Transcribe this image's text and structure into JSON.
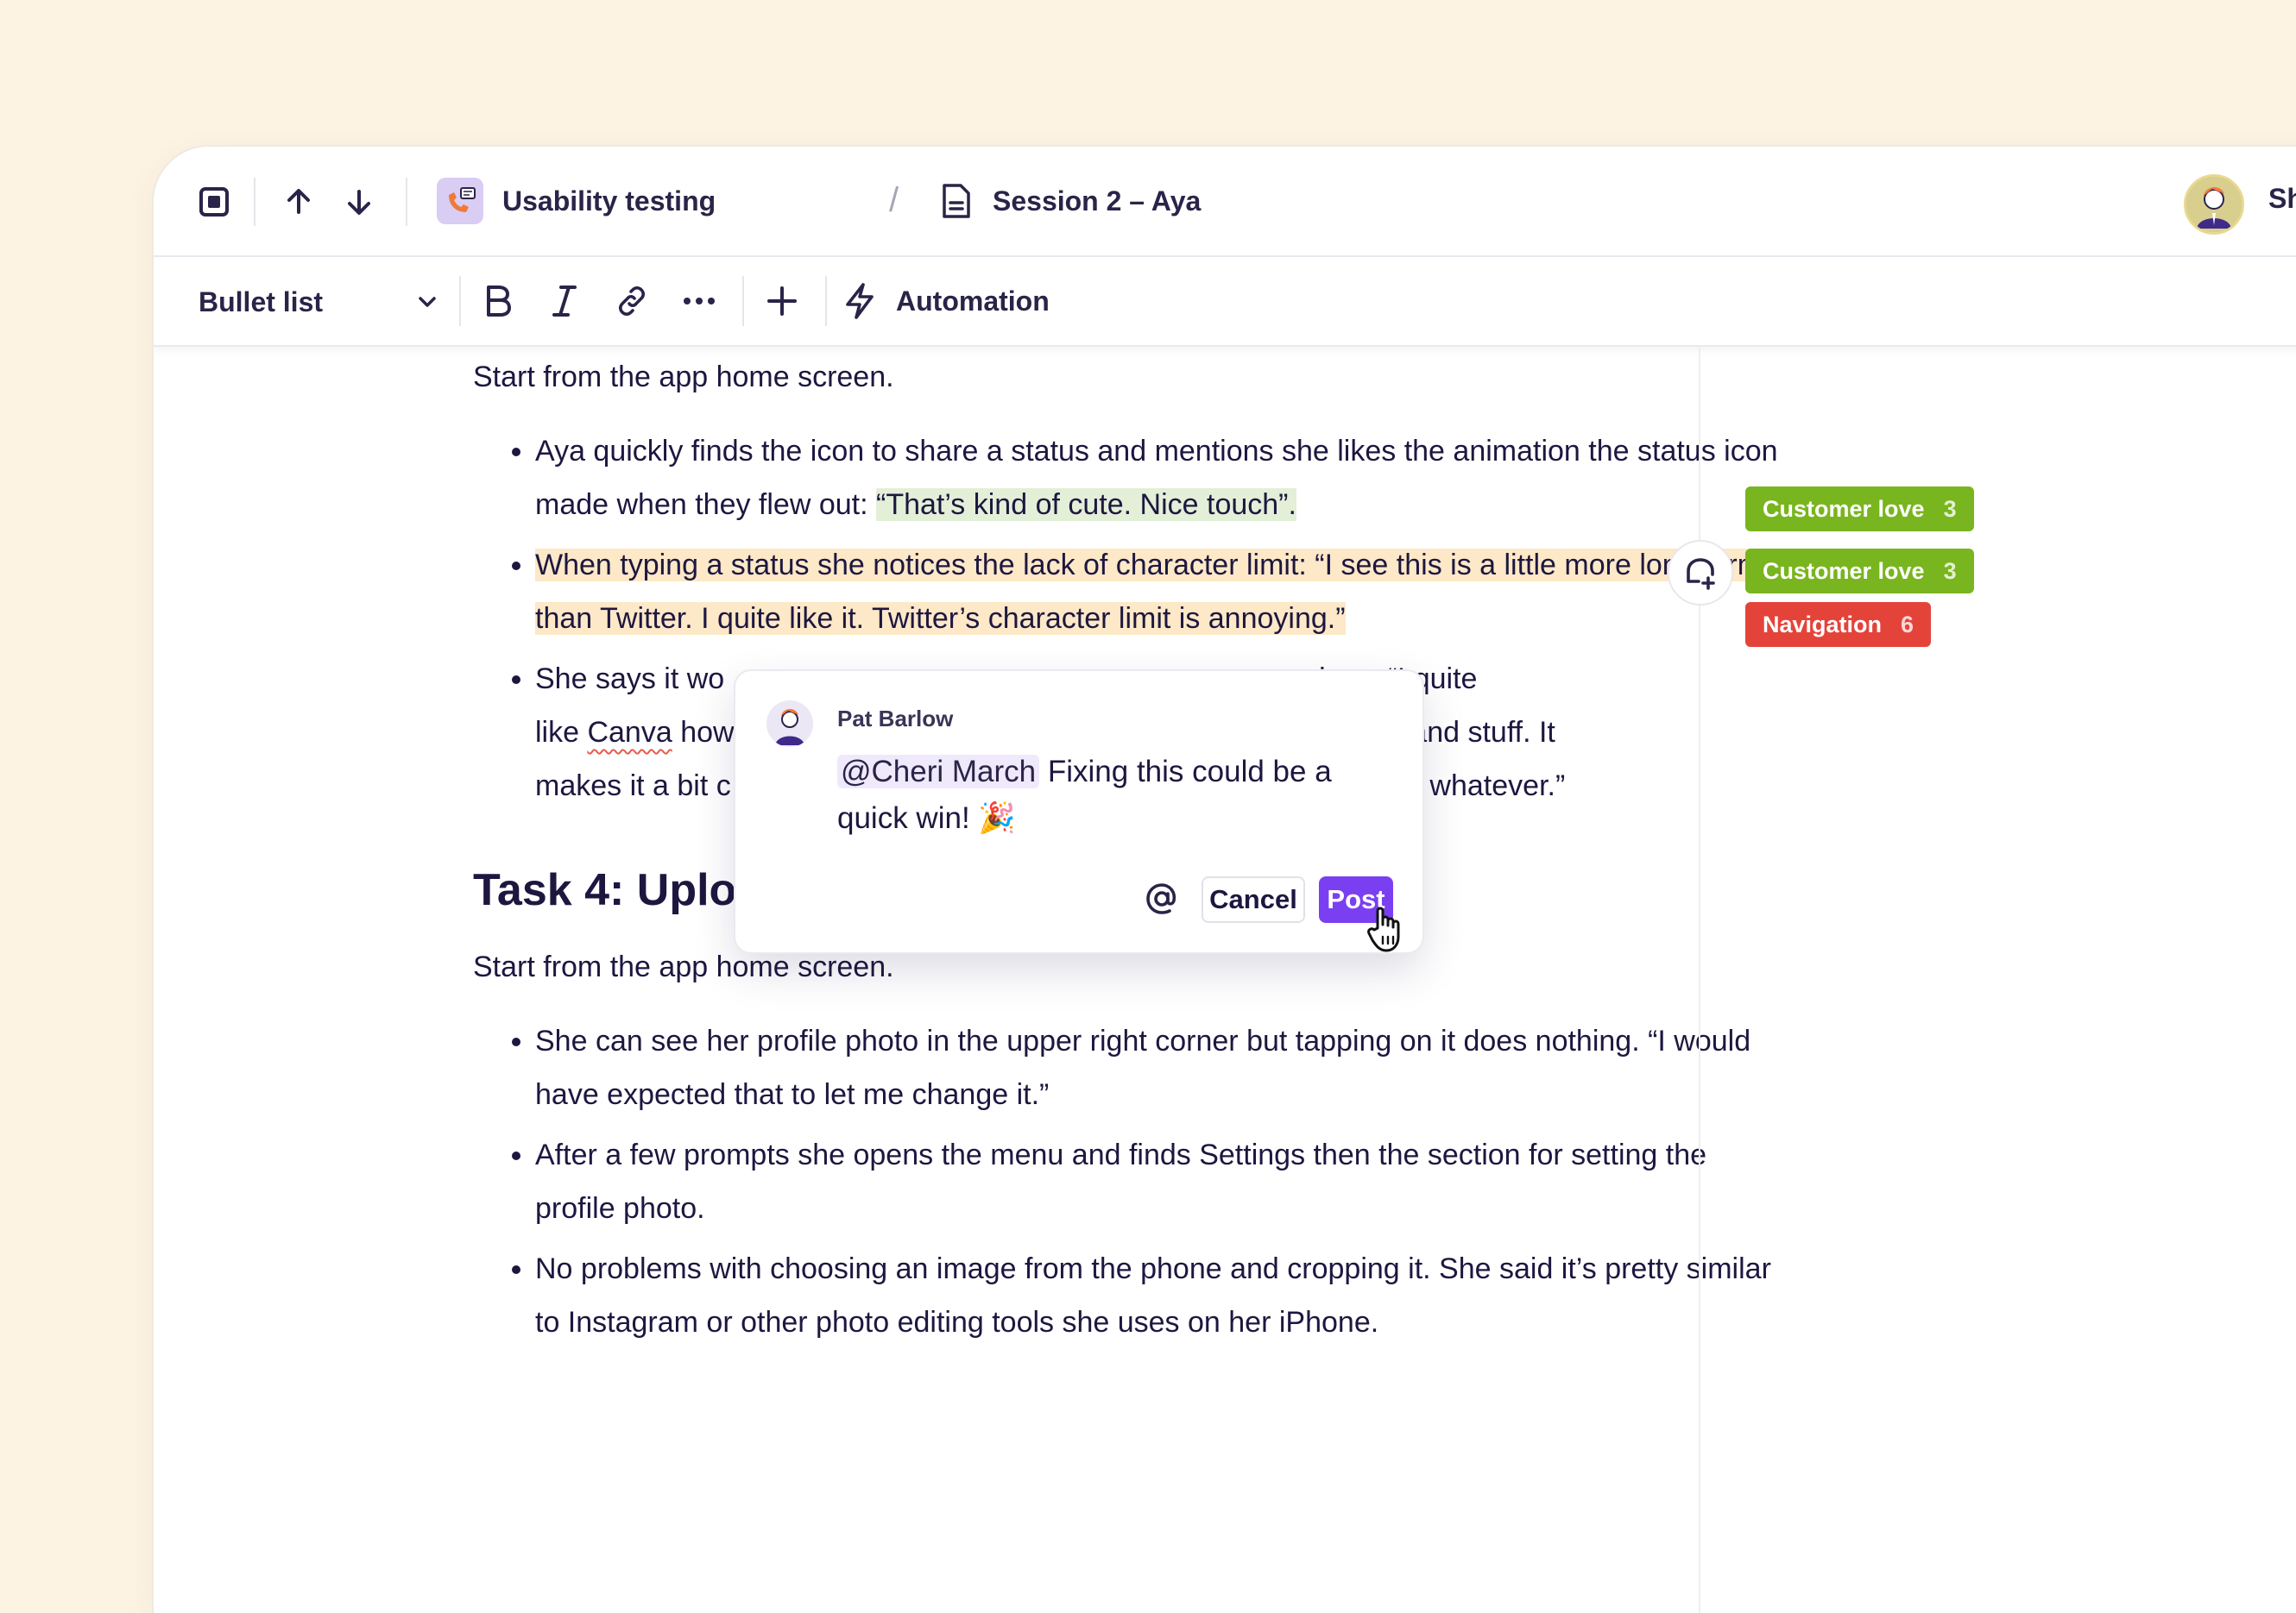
{
  "breadcrumb": {
    "project": "Usability testing",
    "separator": "/",
    "document": "Session 2 – Aya"
  },
  "user": {
    "initials": "Sh"
  },
  "toolbar": {
    "format_select": "Bullet list",
    "automation_label": "Automation"
  },
  "document": {
    "intro": "Start from the app home screen.",
    "bullets_task3": {
      "b1_part1": "Aya quickly finds the icon to share a status and mentions she likes the animation the status icon made when they flew out: ",
      "b1_highlight": "“That’s kind of cute. Nice touch”.",
      "b2_highlight": "When typing a status she notices the lack of character limit: “I see this is a little more long form than Twitter. I quite like it. Twitter’s character limit is annoying.”",
      "b3_part1": "She says it wo",
      "b3_part2": "oices. “I quite",
      "b3_line2a": "like ",
      "b3_canva": "Canva",
      "b3_line2b": " how",
      "b3_line2c": "onts and stuff. It",
      "b3_line3a": "makes it a bit c",
      "b3_line3b": "or whatever.”"
    },
    "task4_heading": "Task 4: Uplo",
    "task4_intro": "Start from the app home screen.",
    "bullets_task4": [
      "She can see her profile photo in the upper right corner but tapping on it does nothing. “I would have expected that to let me change it.”",
      "After a few prompts she opens the menu and finds Settings then the section for setting the profile photo.",
      "No problems with choosing an image from the phone and cropping it. She said it’s pretty similar to Instagram or other photo editing tools she uses on her iPhone."
    ]
  },
  "tags": [
    {
      "label": "Customer love",
      "count": "3",
      "color": "#79b51e"
    },
    {
      "label": "Customer love",
      "count": "3",
      "color": "#79b51e"
    },
    {
      "label": "Navigation",
      "count": "6",
      "color": "#e4433a"
    }
  ],
  "comment": {
    "author": "Pat Barlow",
    "mention": "@Cheri March",
    "text": " Fixing this could be a quick win! 🎉",
    "cancel_label": "Cancel",
    "post_label": "Post"
  },
  "colors": {
    "accent": "#7b3ff2",
    "background": "#fdf3e3",
    "highlight_green": "#e3efd7",
    "highlight_orange": "#fde8c7"
  }
}
